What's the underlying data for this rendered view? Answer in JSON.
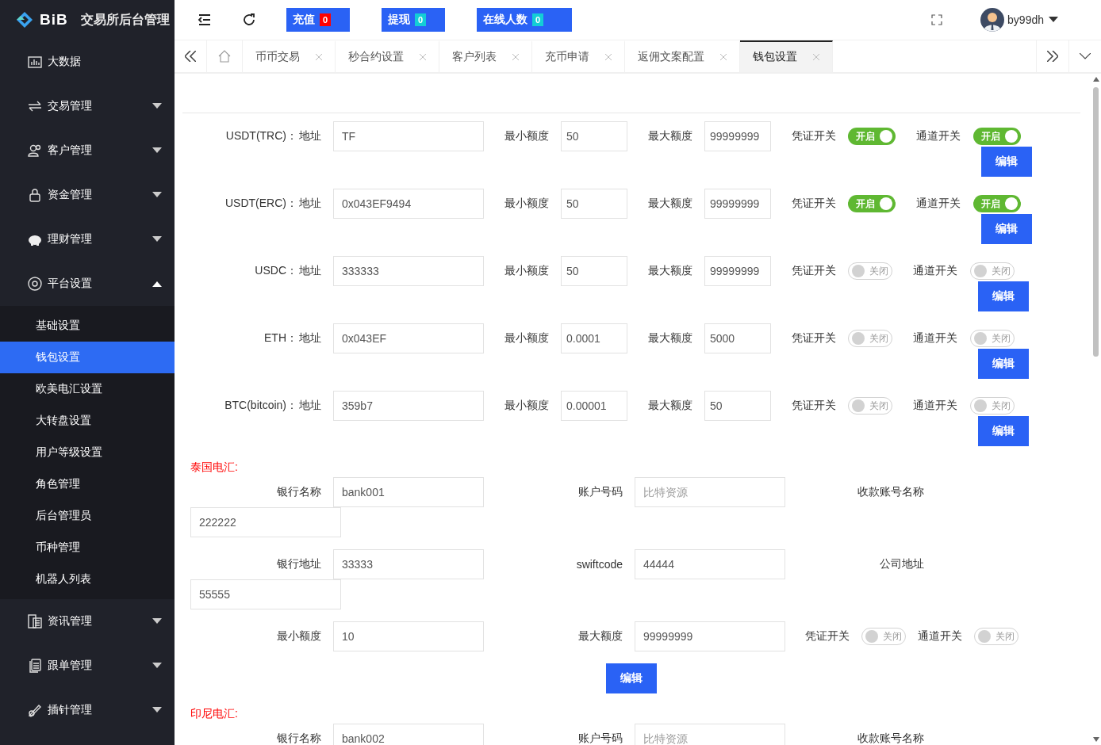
{
  "header": {
    "logo": "BiB",
    "title": "交易所后台管理",
    "badges": [
      {
        "label": "充值",
        "count": "0",
        "color": "#ff0000"
      },
      {
        "label": "提现",
        "count": "0",
        "color": "#13ced6"
      },
      {
        "label": "在线人数",
        "count": "0",
        "color": "#13ced6"
      }
    ],
    "user": "by99dh"
  },
  "sidebar": {
    "items": [
      {
        "label": "大数据"
      },
      {
        "label": "交易管理",
        "expanded": false
      },
      {
        "label": "客户管理",
        "expanded": false
      },
      {
        "label": "资金管理",
        "expanded": false
      },
      {
        "label": "理财管理",
        "expanded": false
      },
      {
        "label": "平台设置",
        "expanded": true,
        "children": [
          {
            "label": "基础设置",
            "selected": false
          },
          {
            "label": "钱包设置",
            "selected": true
          },
          {
            "label": "欧美电汇设置",
            "selected": false
          },
          {
            "label": "大转盘设置",
            "selected": false
          },
          {
            "label": "用户等级设置",
            "selected": false
          },
          {
            "label": "角色管理",
            "selected": false
          },
          {
            "label": "后台管理员",
            "selected": false
          },
          {
            "label": "币种管理",
            "selected": false
          },
          {
            "label": "机器人列表",
            "selected": false
          }
        ]
      },
      {
        "label": "资讯管理",
        "expanded": false
      },
      {
        "label": "跟单管理",
        "expanded": false
      },
      {
        "label": "插针管理",
        "expanded": false
      }
    ]
  },
  "tabs": [
    {
      "label": "币币交易",
      "selected": false
    },
    {
      "label": "秒合约设置",
      "selected": false
    },
    {
      "label": "客户列表",
      "selected": false
    },
    {
      "label": "充币申请",
      "selected": false
    },
    {
      "label": "返佣文案配置",
      "selected": false
    },
    {
      "label": "钱包设置",
      "selected": true
    }
  ],
  "coins": [
    {
      "name": "USDT(TRC)：",
      "address_label": "地址",
      "address": "TF",
      "min_label": "最小额度",
      "min": "50",
      "max_label": "最大额度",
      "max": "99999999",
      "voucher_label": "凭证开关",
      "voucher": {
        "on": true,
        "text": "开启"
      },
      "channel_label": "通道开关",
      "channel": {
        "on": true,
        "text": "开启"
      },
      "button": "编辑"
    },
    {
      "name": "USDT(ERC)：",
      "address_label": "地址",
      "address": "0x043EF9494",
      "min_label": "最小额度",
      "min": "50",
      "max_label": "最大额度",
      "max": "99999999",
      "voucher_label": "凭证开关",
      "voucher": {
        "on": true,
        "text": "开启"
      },
      "channel_label": "通道开关",
      "channel": {
        "on": true,
        "text": "开启"
      },
      "button": "编辑"
    },
    {
      "name": "USDC：",
      "address_label": "地址",
      "address": "333333",
      "min_label": "最小额度",
      "min": "50",
      "max_label": "最大额度",
      "max": "99999999",
      "voucher_label": "凭证开关",
      "voucher": {
        "on": false,
        "text": "关闭"
      },
      "channel_label": "通道开关",
      "channel": {
        "on": false,
        "text": "关闭"
      },
      "button": "编辑"
    },
    {
      "name": "ETH：",
      "address_label": "地址",
      "address": "0x043EF",
      "min_label": "最小额度",
      "min": "0.0001",
      "max_label": "最大额度",
      "max": "5000",
      "voucher_label": "凭证开关",
      "voucher": {
        "on": false,
        "text": "关闭"
      },
      "channel_label": "通道开关",
      "channel": {
        "on": false,
        "text": "关闭"
      },
      "button": "编辑"
    },
    {
      "name": "BTC(bitcoin)：",
      "address_label": "地址",
      "address": "359b7",
      "min_label": "最小额度",
      "min": "0.00001",
      "max_label": "最大额度",
      "max": "50",
      "voucher_label": "凭证开关",
      "voucher": {
        "on": false,
        "text": "关闭"
      },
      "channel_label": "通道开关",
      "channel": {
        "on": false,
        "text": "关闭"
      },
      "button": "编辑"
    }
  ],
  "wires": [
    {
      "title": "泰国电汇:",
      "fields": [
        {
          "label": "银行名称",
          "value": "bank001"
        },
        {
          "label": "账户号码",
          "placeholder": "比特资源"
        },
        {
          "label": "收款账号名称",
          "value": "222222"
        },
        {
          "label": "银行地址",
          "value": "33333"
        },
        {
          "label": "swiftcode",
          "value": "44444"
        },
        {
          "label": "公司地址",
          "value": "55555"
        },
        {
          "label": "最小额度",
          "value": "10"
        },
        {
          "label": "最大额度",
          "value": "99999999"
        }
      ],
      "switches": [
        {
          "label": "凭证开关",
          "on": false,
          "text": "关闭"
        },
        {
          "label": "通道开关",
          "on": false,
          "text": "关闭"
        }
      ],
      "button": "编辑"
    },
    {
      "title": "印尼电汇:",
      "fields": [
        {
          "label": "银行名称",
          "value": "bank002"
        },
        {
          "label": "账户号码",
          "placeholder": "比特资源"
        },
        {
          "label": "收款账号名称"
        }
      ]
    }
  ]
}
